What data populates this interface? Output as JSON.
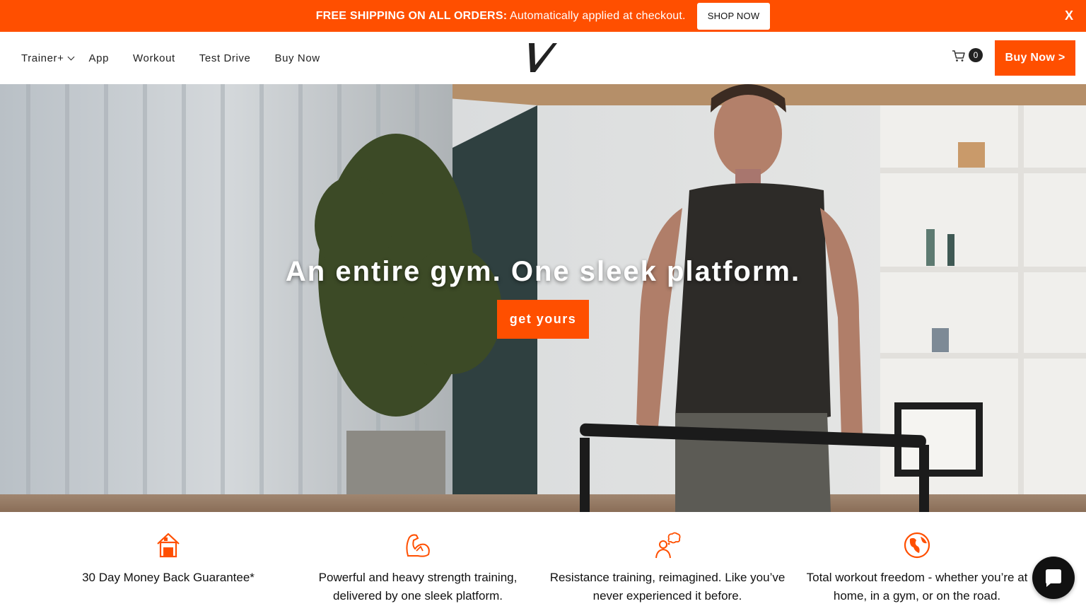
{
  "announcement": {
    "bold": "FREE SHIPPING ON ALL ORDERS:",
    "text": " Automatically applied at checkout.",
    "button": "SHOP NOW",
    "close": "X"
  },
  "nav": {
    "items": [
      "Trainer+",
      "App",
      "Workout",
      "Test Drive",
      "Buy Now"
    ],
    "cart_count": "0",
    "cta": "Buy Now >"
  },
  "hero": {
    "title": "An entire gym. One sleek platform.",
    "cta": "get yours"
  },
  "features": [
    {
      "icon": "house-30-icon",
      "text": "30 Day Money Back Guarantee*"
    },
    {
      "icon": "flexed-arm-icon",
      "text": "Powerful and heavy strength training, delivered by one sleek platform."
    },
    {
      "icon": "person-thinking-icon",
      "text": "Resistance training, reimagined. Like you’ve never experienced it before."
    },
    {
      "icon": "globe-icon",
      "text": "Total workout freedom - whether you’re at home, in a gym, or on the road."
    }
  ],
  "colors": {
    "accent": "#ff4f00",
    "dark": "#111111"
  }
}
